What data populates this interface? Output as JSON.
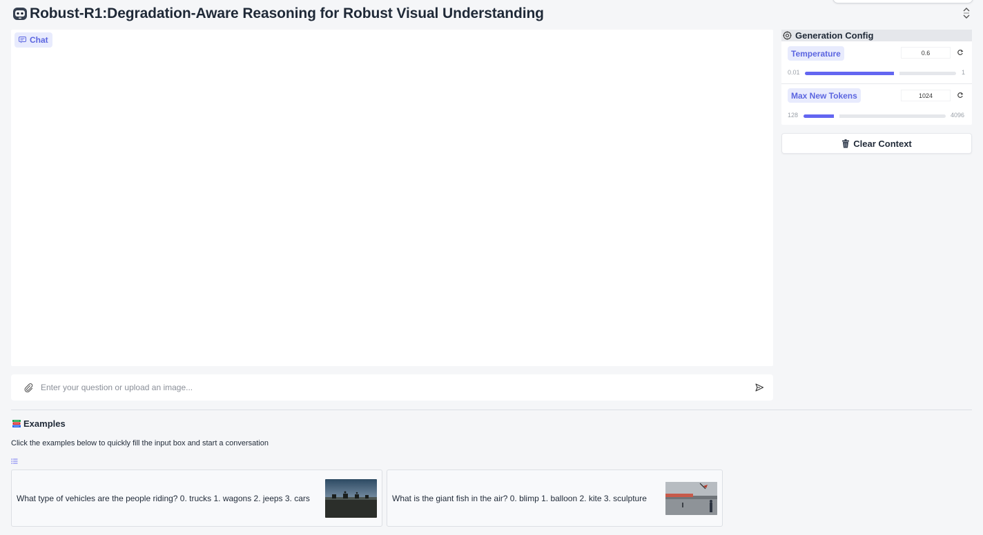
{
  "header": {
    "title": "Robust-R1:Degradation-Aware Reasoning for Robust Visual Understanding",
    "logo_icon": "robot-face-icon"
  },
  "chat": {
    "label": "Chat",
    "icon": "chat-bubble-icon"
  },
  "input": {
    "placeholder": "Enter your question or upload an image...",
    "value": ""
  },
  "config": {
    "title": "Generation Config",
    "accent": "#6366f1",
    "temperature": {
      "label": "Temperature",
      "value": "0.6",
      "min": "0.01",
      "max": "1",
      "level": 0.6
    },
    "max_tokens": {
      "label": "Max New Tokens",
      "value": "1024",
      "min": "128",
      "max": "4096",
      "level": 0.225
    }
  },
  "clear_button": {
    "label": "Clear Context",
    "icon": "trash-icon"
  },
  "examples": {
    "title": "Examples",
    "description": "Click the examples below to quickly fill the input box and start a conversation",
    "items": [
      {
        "text": "What type of vehicles are the people riding? 0. trucks 1. wagons 2. jeeps 3. cars"
      },
      {
        "text": "What is the giant fish in the air? 0. blimp 1. balloon 2. kite 3. sculpture"
      }
    ]
  }
}
